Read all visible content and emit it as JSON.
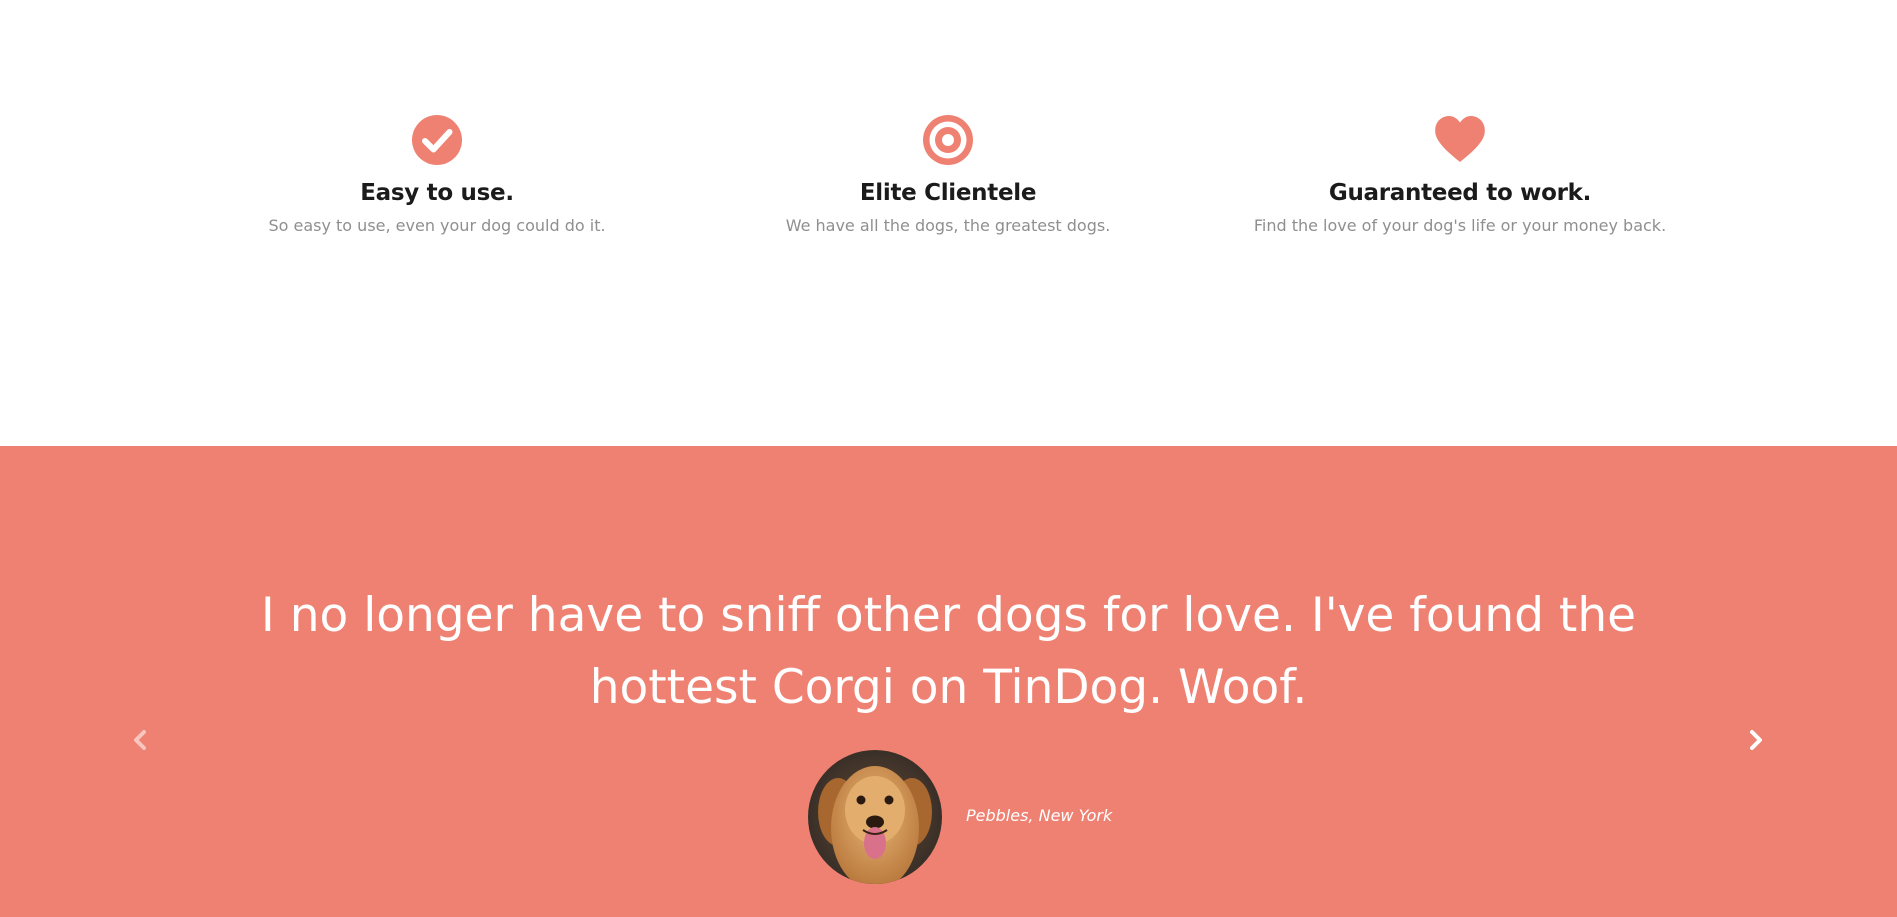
{
  "colors": {
    "accent": "#ef8172",
    "heading": "#1b1b1b",
    "muted": "#8f8f8f",
    "white": "#ffffff"
  },
  "features": [
    {
      "icon": "check-circle-icon",
      "title": "Easy to use.",
      "description": "So easy to use, even your dog could do it."
    },
    {
      "icon": "bullseye-icon",
      "title": "Elite Clientele",
      "description": "We have all the dogs, the greatest dogs."
    },
    {
      "icon": "heart-icon",
      "title": "Guaranteed to work.",
      "description": "Find the love of your dog's life or your money back."
    }
  ],
  "testimonial": {
    "quote": "I no longer have to sniff other dogs for love. I've found the hottest Corgi on TinDog. Woof.",
    "author": "Pebbles, New York",
    "avatar_icon": "dog-avatar",
    "prev_icon": "chevron-left-icon",
    "next_icon": "chevron-right-icon"
  }
}
